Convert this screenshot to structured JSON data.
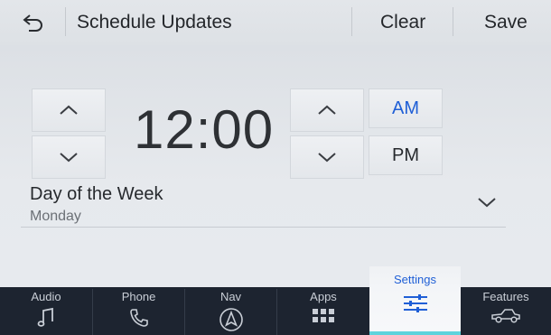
{
  "header": {
    "title": "Schedule Updates",
    "clear_label": "Clear",
    "save_label": "Save"
  },
  "time": {
    "value": "12:00",
    "am_label": "AM",
    "pm_label": "PM",
    "selected_period": "AM"
  },
  "day_of_week": {
    "label": "Day of the Week",
    "value": "Monday"
  },
  "nav": {
    "items": [
      {
        "label": "Audio",
        "icon": "music-note-icon"
      },
      {
        "label": "Phone",
        "icon": "phone-icon"
      },
      {
        "label": "Nav",
        "icon": "navigation-arrow-icon"
      },
      {
        "label": "Apps",
        "icon": "apps-grid-icon"
      },
      {
        "label": "Settings",
        "icon": "sliders-icon",
        "active": true
      },
      {
        "label": "Features",
        "icon": "vehicle-icon"
      }
    ]
  },
  "colors": {
    "accent_blue": "#1f5fd6",
    "active_bar": "#5fd3dc",
    "navbar_bg": "#1d2430"
  }
}
